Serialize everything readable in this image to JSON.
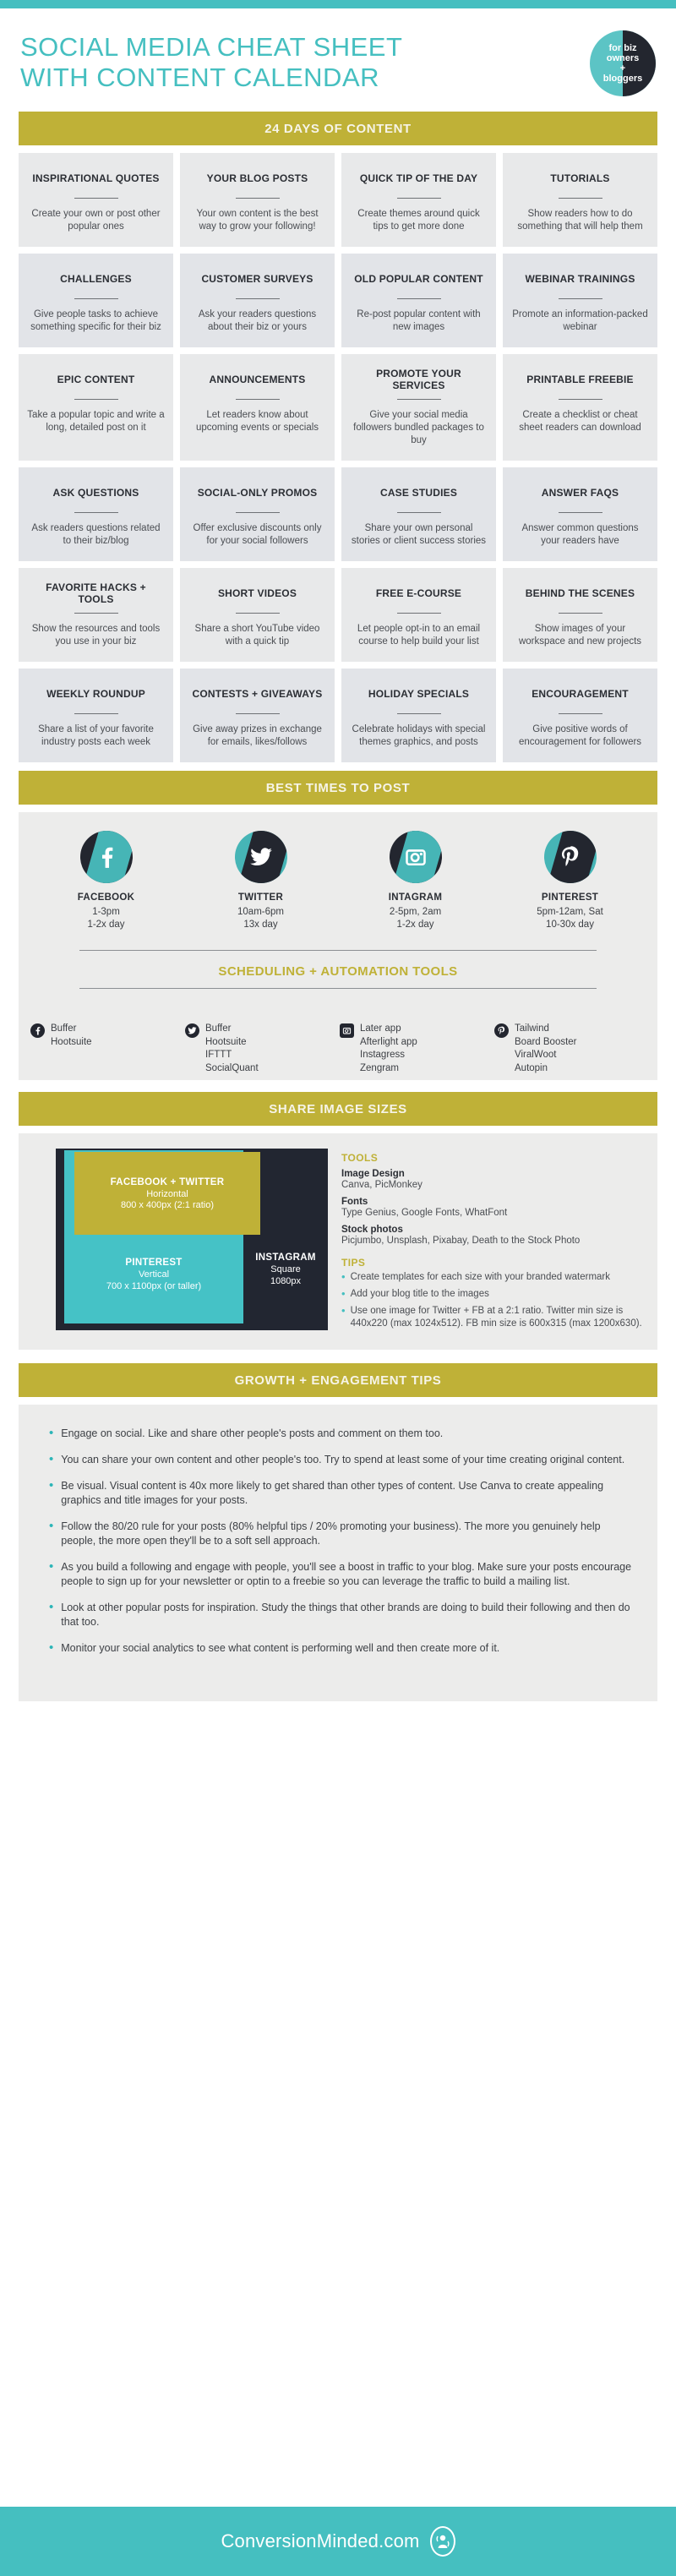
{
  "header": {
    "title_line1": "SOCIAL MEDIA CHEAT SHEET",
    "title_line2": "WITH CONTENT CALENDAR",
    "badge_line1": "for biz",
    "badge_line2": "owners",
    "badge_line3": "+",
    "badge_line4": "bloggers"
  },
  "calendar": {
    "banner": "24 DAYS OF CONTENT",
    "cards": [
      {
        "title": "INSPIRATIONAL QUOTES",
        "desc": "Create your own or post other popular ones"
      },
      {
        "title": "YOUR BLOG POSTS",
        "desc": "Your own content is the best way to grow your following!"
      },
      {
        "title": "QUICK TIP OF THE DAY",
        "desc": "Create themes around quick tips to get more done"
      },
      {
        "title": "TUTORIALS",
        "desc": "Show readers how to do something that will help them"
      },
      {
        "title": "CHALLENGES",
        "desc": "Give people tasks to achieve something specific for their biz"
      },
      {
        "title": "CUSTOMER SURVEYS",
        "desc": "Ask your readers questions about their biz or yours"
      },
      {
        "title": "OLD POPULAR CONTENT",
        "desc": "Re-post popular content with new images"
      },
      {
        "title": "WEBINAR TRAININGS",
        "desc": "Promote an information-packed webinar"
      },
      {
        "title": "EPIC CONTENT",
        "desc": "Take a popular topic and write a long, detailed post on it"
      },
      {
        "title": "ANNOUNCEMENTS",
        "desc": "Let readers know about upcoming events or specials"
      },
      {
        "title": "PROMOTE YOUR SERVICES",
        "desc": "Give your social media followers bundled packages to buy"
      },
      {
        "title": "PRINTABLE FREEBIE",
        "desc": "Create a checklist or cheat sheet readers can download"
      },
      {
        "title": "ASK QUESTIONS",
        "desc": "Ask readers questions related to their biz/blog"
      },
      {
        "title": "SOCIAL-ONLY PROMOS",
        "desc": "Offer exclusive discounts only for your social followers"
      },
      {
        "title": "CASE STUDIES",
        "desc": "Share your own personal stories or client success stories"
      },
      {
        "title": "ANSWER FAQs",
        "desc": "Answer common questions your readers have"
      },
      {
        "title": "FAVORITE HACKS + TOOLS",
        "desc": "Show the resources and tools you use in your biz"
      },
      {
        "title": "SHORT VIDEOS",
        "desc": "Share a short YouTube video with a quick tip"
      },
      {
        "title": "FREE E-COURSE",
        "desc": "Let people opt-in to an email course to help build your list"
      },
      {
        "title": "BEHIND THE SCENES",
        "desc": "Show images of your workspace and new projects"
      },
      {
        "title": "WEEKLY ROUNDUP",
        "desc": "Share a list of your favorite industry posts each week"
      },
      {
        "title": "CONTESTS + GIVEAWAYS",
        "desc": "Give away prizes in exchange for emails, likes/follows"
      },
      {
        "title": "HOLIDAY SPECIALS",
        "desc": "Celebrate holidays with special themes graphics, and posts"
      },
      {
        "title": "ENCOURAGEMENT",
        "desc": "Give positive words of encouragement for followers"
      }
    ]
  },
  "best_times": {
    "banner": "BEST TIMES TO POST",
    "networks": [
      {
        "icon": "facebook-icon",
        "name": "FACEBOOK",
        "time": "1-3pm",
        "frequency": "1-2x day"
      },
      {
        "icon": "twitter-icon",
        "name": "TWITTER",
        "time": "10am-6pm",
        "frequency": "13x day"
      },
      {
        "icon": "instagram-icon",
        "name": "INTAGRAM",
        "time": "2-5pm, 2am",
        "frequency": "1-2x day"
      },
      {
        "icon": "pinterest-icon",
        "name": "PINTEREST",
        "time": "5pm-12am, Sat",
        "frequency": "10-30x day"
      }
    ],
    "tools_heading": "SCHEDULING + AUTOMATION TOOLS",
    "tools": [
      {
        "icon": "facebook-icon",
        "items": "Buffer\nHootsuite"
      },
      {
        "icon": "twitter-icon",
        "items": "Buffer\nHootsuite\nIFTTT\nSocialQuant"
      },
      {
        "icon": "instagram-icon",
        "items": "Later app\nAfterlight app\nInstagress\nZengram"
      },
      {
        "icon": "pinterest-icon",
        "items": "Tailwind\nBoard Booster\nViralWoot\nAutopin"
      }
    ]
  },
  "image_sizes": {
    "banner": "SHARE IMAGE SIZES",
    "facebook_twitter": {
      "title": "FACEBOOK + TWITTER",
      "orientation": "Horizontal",
      "dimensions": "800 x 400px (2:1 ratio)"
    },
    "pinterest": {
      "title": "PINTEREST",
      "orientation": "Vertical",
      "dimensions": "700 x 1100px (or taller)"
    },
    "instagram": {
      "title": "INSTAGRAM",
      "orientation": "Square",
      "dimensions": "1080px"
    },
    "tools_heading": "TOOLS",
    "tool_groups": [
      {
        "label": "Image Design",
        "value": "Canva, PicMonkey"
      },
      {
        "label": "Fonts",
        "value": "Type Genius, Google Fonts, WhatFont"
      },
      {
        "label": "Stock photos",
        "value": "Picjumbo, Unsplash, Pixabay, Death to the Stock Photo"
      }
    ],
    "tips_heading": "TIPS",
    "tips": [
      "Create templates for each size with your branded watermark",
      "Add your blog title to the images",
      "Use one image for Twitter + FB at a 2:1 ratio. Twitter min size is 440x220 (max 1024x512).  FB min size is 600x315 (max 1200x630)."
    ]
  },
  "growth": {
    "banner": "GROWTH + ENGAGEMENT TIPS",
    "tips": [
      "Engage on social. Like and share other people's posts and comment on them too.",
      "You can share your own content and other people's too. Try to spend at least some of your time creating original content.",
      "Be visual. Visual content is 40x more likely to get shared than other types of content. Use Canva to create appealing graphics and title images for your posts.",
      "Follow the 80/20 rule for your posts (80% helpful tips / 20% promoting your business). The more you genuinely help people, the more open they'll be to a soft sell approach.",
      "As you build a following and engage with people, you'll see a boost in traffic to your blog. Make sure your posts encourage people to sign up for your newsletter or optin to a freebie so you can leverage the traffic to build a mailing list.",
      "Look at other popular posts for inspiration. Study the things that other brands are doing to build their following and then do that too.",
      "Monitor your social analytics to see what content is performing well and then create more of it."
    ]
  },
  "footer": {
    "brand": "ConversionMinded.com"
  },
  "colors": {
    "teal": "#45bfc0",
    "gold": "#bfb137",
    "dark": "#23262f",
    "panel": "#ececeb"
  }
}
